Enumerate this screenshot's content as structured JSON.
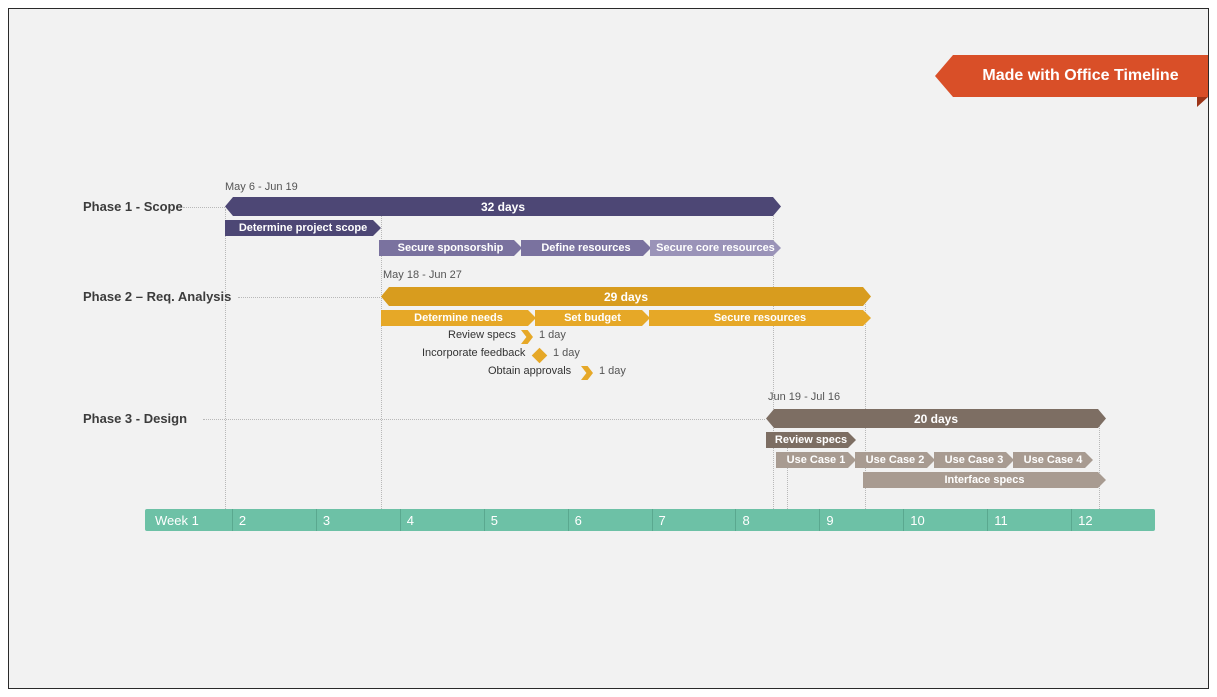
{
  "ribbon": {
    "label": "Made with Office Timeline"
  },
  "scale": {
    "label_first": "Week 1",
    "ticks": [
      "2",
      "3",
      "4",
      "5",
      "6",
      "7",
      "8",
      "9",
      "10",
      "11",
      "12"
    ]
  },
  "phase1": {
    "label": "Phase 1 - Scope",
    "date_range": "May 6 - Jun 19",
    "duration": "32 days",
    "tasks": {
      "scope": "Determine project scope",
      "sponsor": "Secure sponsorship",
      "define": "Define resources",
      "core": "Secure core resources"
    }
  },
  "phase2": {
    "label": "Phase 2 – Req. Analysis",
    "date_range": "May 18 - Jun 27",
    "duration": "29 days",
    "tasks": {
      "needs": "Determine needs",
      "budget": "Set budget",
      "resources": "Secure resources",
      "review": "Review specs",
      "review_dur": "1 day",
      "feedback": "Incorporate feedback",
      "feedback_dur": "1 day",
      "approvals": "Obtain approvals",
      "approvals_dur": "1 day"
    }
  },
  "phase3": {
    "label": "Phase 3 - Design",
    "date_range": "Jun 19 - Jul 16",
    "duration": "20 days",
    "tasks": {
      "review": "Review specs",
      "uc1": "Use Case 1",
      "uc2": "Use Case 2",
      "uc3": "Use Case 3",
      "uc4": "Use Case 4",
      "interface": "Interface specs"
    }
  },
  "chart_data": {
    "type": "bar",
    "title": "",
    "xlabel": "Week",
    "ylabel": "",
    "x_ticks": [
      "Week 1",
      "2",
      "3",
      "4",
      "5",
      "6",
      "7",
      "8",
      "9",
      "10",
      "11",
      "12"
    ],
    "series": [
      {
        "name": "Phase 1 - Scope",
        "date_range": "May 6 - Jun 19",
        "start_week": 1,
        "end_week": 7.3,
        "duration_days": 32,
        "tasks": [
          {
            "name": "Determine project scope",
            "start_week": 1,
            "end_week": 2.7
          },
          {
            "name": "Secure sponsorship",
            "start_week": 2.7,
            "end_week": 4.3
          },
          {
            "name": "Define resources",
            "start_week": 4.3,
            "end_week": 5.7
          },
          {
            "name": "Secure core resources",
            "start_week": 5.7,
            "end_week": 7.3
          }
        ]
      },
      {
        "name": "Phase 2 – Req. Analysis",
        "date_range": "May 18 - Jun 27",
        "start_week": 2.7,
        "end_week": 8.5,
        "duration_days": 29,
        "tasks": [
          {
            "name": "Determine needs",
            "start_week": 2.7,
            "end_week": 4.4
          },
          {
            "name": "Set budget",
            "start_week": 4.4,
            "end_week": 5.7
          },
          {
            "name": "Secure resources",
            "start_week": 5.7,
            "end_week": 8.5
          },
          {
            "name": "Review specs",
            "start_week": 4.0,
            "duration_days": 1,
            "milestone": true
          },
          {
            "name": "Incorporate feedback",
            "start_week": 4.1,
            "duration_days": 1,
            "milestone": true
          },
          {
            "name": "Obtain approvals",
            "start_week": 4.7,
            "duration_days": 1,
            "milestone": true
          }
        ]
      },
      {
        "name": "Phase 3 - Design",
        "date_range": "Jun 19 - Jul 16",
        "start_week": 7.3,
        "end_week": 11.2,
        "duration_days": 20,
        "tasks": [
          {
            "name": "Review specs",
            "start_week": 7.3,
            "end_week": 8.2
          },
          {
            "name": "Use Case 1",
            "start_week": 7.4,
            "end_week": 8.3
          },
          {
            "name": "Use Case 2",
            "start_week": 8.3,
            "end_week": 9.3
          },
          {
            "name": "Use Case 3",
            "start_week": 9.3,
            "end_week": 10.2
          },
          {
            "name": "Use Case 4",
            "start_week": 10.2,
            "end_week": 11.1
          },
          {
            "name": "Interface specs",
            "start_week": 8.4,
            "end_week": 11.2
          }
        ]
      }
    ]
  }
}
